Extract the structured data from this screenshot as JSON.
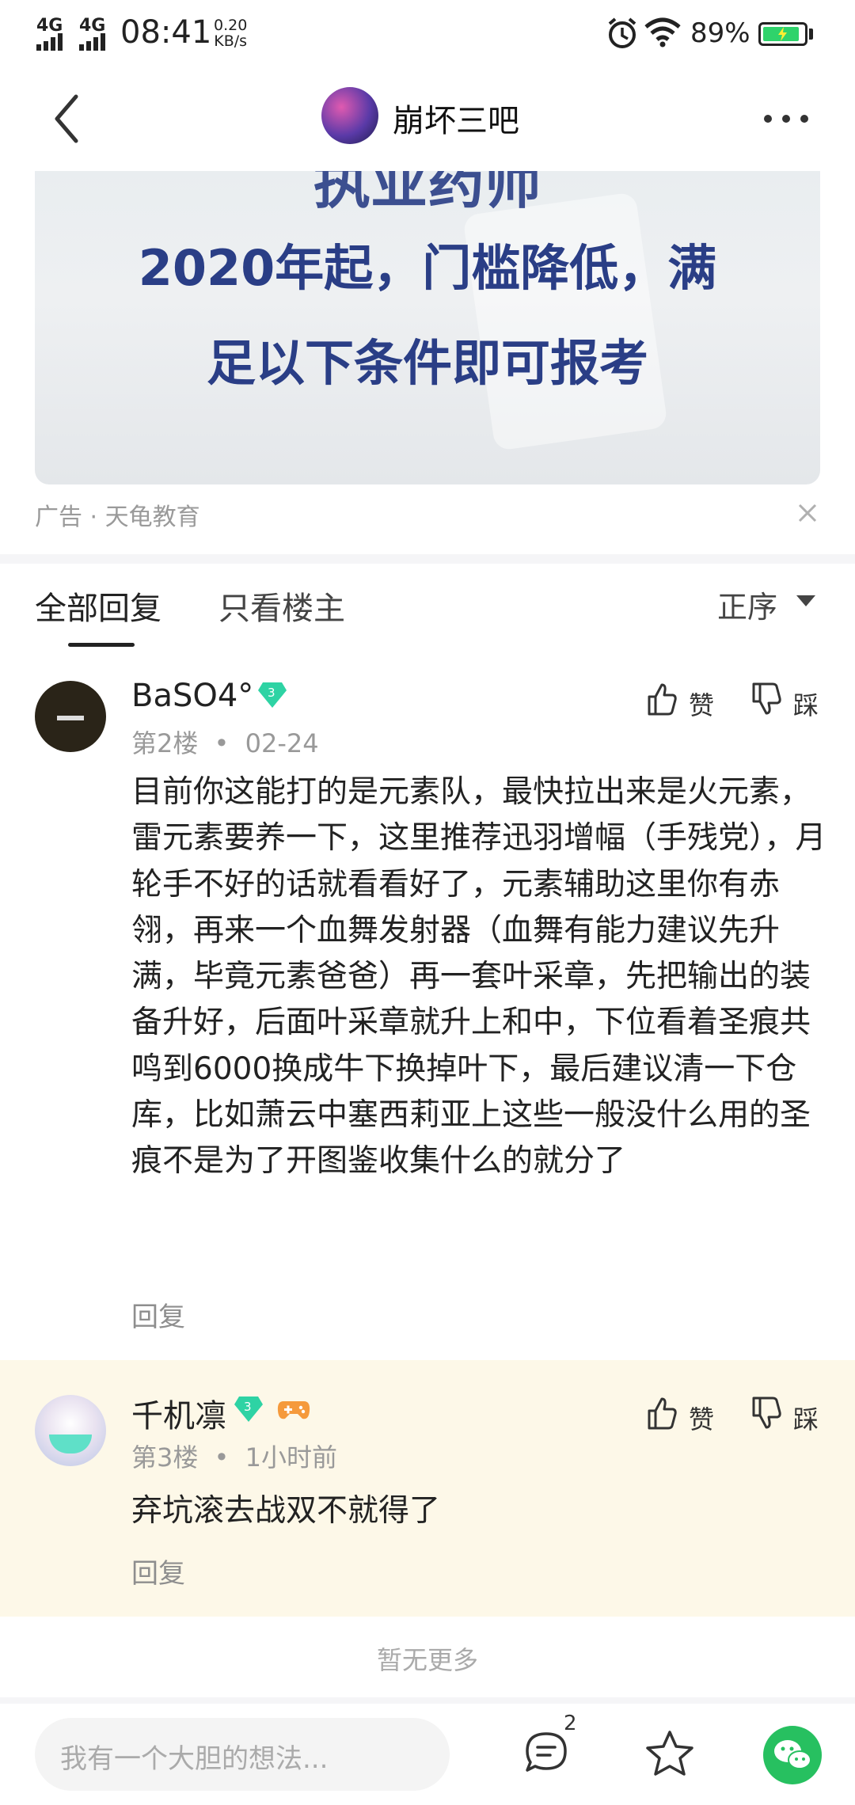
{
  "status_bar": {
    "signal1": "4G",
    "signal2": "4G",
    "time": "08:41",
    "speed_value": "0.20",
    "speed_unit": "KB/s",
    "battery_pct": "89%",
    "battery_level": 0.89
  },
  "nav": {
    "title": "崩坏三吧"
  },
  "ad": {
    "lines": [
      "执业药师",
      "2020年起，门槛降低，满",
      "足以下条件即可报考"
    ],
    "source": "广告 · 天龟教育"
  },
  "tabs": {
    "all_replies": "全部回复",
    "only_op": "只看楼主",
    "sort": "正序"
  },
  "replies": [
    {
      "username": "BaSO4°",
      "level": "3",
      "floor": "第2楼",
      "time": "02-24",
      "content": "目前你这能打的是元素队，最快拉出来是火元素，雷元素要养一下，这里推荐迅羽增幅（手残党），月轮手不好的话就看看好了，元素辅助这里你有赤翎，再来一个血舞发射器（血舞有能力建议先升满，毕竟元素爸爸）再一套叶采章，先把输出的装备升好，后面叶采章就升上和中，下位看着圣痕共鸣到6000换成牛下换掉叶下，最后建议清一下仓库，比如萧云中塞西莉亚上这些一般没什么用的圣痕不是为了开图鉴收集什么的就分了",
      "reply": "回复",
      "like": "赞",
      "dislike": "踩"
    },
    {
      "username": "千机凛",
      "level": "3",
      "floor": "第3楼",
      "time": "1小时前",
      "content": "弃坑滚去战双不就得了",
      "reply": "回复",
      "like": "赞",
      "dislike": "踩"
    }
  ],
  "footer": {
    "no_more": "暂无更多",
    "input_placeholder": "我有一个大胆的想法...",
    "comment_count": "2"
  },
  "colors": {
    "accent_green": "#27c060",
    "gem_teal": "#2ed3a4",
    "highlight_bg": "#fdf8e8"
  }
}
